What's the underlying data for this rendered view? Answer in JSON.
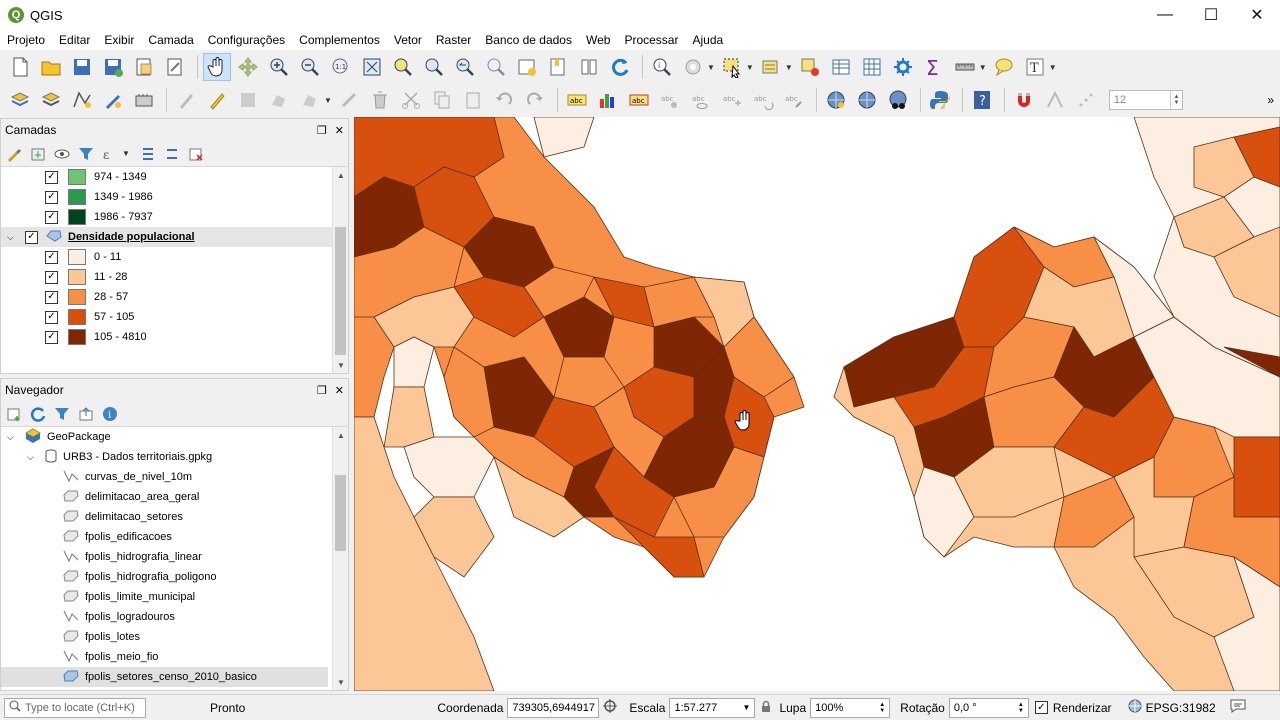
{
  "window": {
    "title": "QGIS"
  },
  "menu": [
    "Projeto",
    "Editar",
    "Exibir",
    "Camada",
    "Configurações",
    "Complementos",
    "Vetor",
    "Raster",
    "Banco de dados",
    "Web",
    "Processar",
    "Ajuda"
  ],
  "toolbar": {
    "label_size_value": "12"
  },
  "layers_panel": {
    "title": "Camadas",
    "items": [
      {
        "label": "974 - 1349",
        "color": "#6fc372",
        "checked": true
      },
      {
        "label": "1349 - 1986",
        "color": "#2a9b4c",
        "checked": true
      },
      {
        "label": "1986 - 7937",
        "color": "#00441b",
        "checked": true
      }
    ],
    "group": {
      "label": "Densidade populacional",
      "checked": true
    },
    "classes": [
      {
        "label": "0 - 11",
        "color": "#fdeee2",
        "checked": true
      },
      {
        "label": "11 - 28",
        "color": "#fbc796",
        "checked": true
      },
      {
        "label": "28 - 57",
        "color": "#f88f47",
        "checked": true
      },
      {
        "label": "57 - 105",
        "color": "#d8500e",
        "checked": true
      },
      {
        "label": "105 - 4810",
        "color": "#7f2704",
        "checked": true
      }
    ]
  },
  "browser_panel": {
    "title": "Navegador",
    "root": "GeoPackage",
    "database": "URB3 - Dados territoriais.gpkg",
    "layers": [
      {
        "name": "curvas_de_nivel_10m",
        "geom": "line"
      },
      {
        "name": "delimitacao_area_geral",
        "geom": "polygon"
      },
      {
        "name": "delimitacao_setores",
        "geom": "polygon"
      },
      {
        "name": "fpolis_edificacoes",
        "geom": "polygon"
      },
      {
        "name": "fpolis_hidrografia_linear",
        "geom": "line"
      },
      {
        "name": "fpolis_hidrografia_poligono",
        "geom": "polygon"
      },
      {
        "name": "fpolis_limite_municipal",
        "geom": "polygon"
      },
      {
        "name": "fpolis_logradouros",
        "geom": "line"
      },
      {
        "name": "fpolis_lotes",
        "geom": "polygon"
      },
      {
        "name": "fpolis_meio_fio",
        "geom": "line"
      },
      {
        "name": "fpolis_setores_censo_2010_basico",
        "geom": "polygon",
        "selected": true
      }
    ]
  },
  "status": {
    "locate_placeholder": "Type to locate (Ctrl+K)",
    "message": "Pronto",
    "coord_label": "Coordenada",
    "coord_value": "739305,6944917",
    "scale_label": "Escala",
    "scale_value": "1:57.277",
    "magnifier_label": "Lupa",
    "magnifier_value": "100%",
    "rotation_label": "Rotação",
    "rotation_value": "0,0 °",
    "render_label": "Renderizar",
    "crs": "EPSG:31982"
  }
}
